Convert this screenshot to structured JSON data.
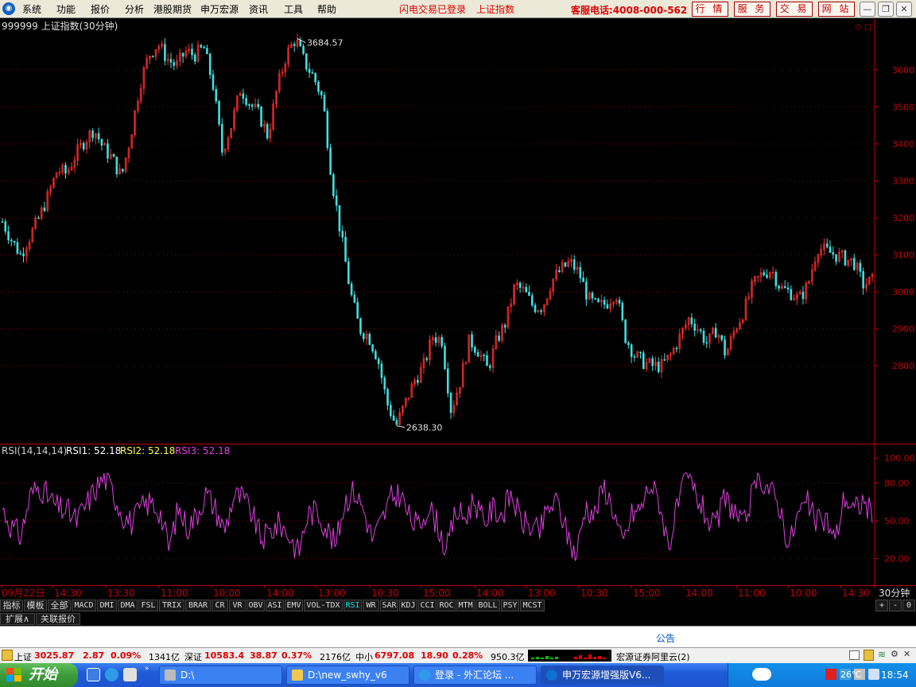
{
  "menubar": {
    "items": [
      "系统",
      "功能",
      "报价",
      "分析",
      "港股期货",
      "申万宏源",
      "资讯",
      "工具",
      "帮助"
    ],
    "flash_status": "闪电交易已登录",
    "index_link": "上证指数",
    "hotline": "客服电话:4008-000-562",
    "buttons": [
      "行 情",
      "服 务",
      "交 易",
      "网 站"
    ]
  },
  "chart": {
    "title": "999999 上证指数(30分钟)",
    "high_label": "3684.57",
    "low_label": "2638.30",
    "rsi_header": "RSI(14,14,14)",
    "rsi1": "RSI1: 52.18",
    "rsi2": "RSI2: 52.18",
    "rsi3": "RSI3: 52.18",
    "period_label": "30分钟",
    "colors": {
      "up": "#ff3030",
      "down": "#40e0e0",
      "rsi": "#e040e0",
      "axis": "#c00000",
      "grid": "#800000"
    }
  },
  "chart_data": {
    "type": "line",
    "price_axis": {
      "ticks": [
        2800,
        2900,
        3000,
        3100,
        3200,
        3300,
        3400,
        3500,
        3600
      ],
      "ylim": [
        2620,
        3720
      ]
    },
    "rsi_axis": {
      "ticks": [
        "20.00",
        "50.00",
        "80.00",
        "100.00"
      ],
      "ylim": [
        0,
        100
      ]
    },
    "x_ticks": [
      "09月22日",
      "14:30",
      "13:30",
      "11:00",
      "10:00",
      "14:00",
      "13:00",
      "10:30",
      "15:00",
      "14:00",
      "13:00",
      "10:30",
      "15:00",
      "14:00",
      "11:00",
      "10:00",
      "14:30"
    ],
    "series": [
      {
        "name": "上证指数",
        "values": [
          3190,
          3140,
          3100,
          3150,
          3200,
          3260,
          3330,
          3320,
          3370,
          3410,
          3440,
          3390,
          3360,
          3310,
          3420,
          3560,
          3640,
          3670,
          3630,
          3610,
          3650,
          3640,
          3660,
          3560,
          3380,
          3450,
          3550,
          3510,
          3480,
          3420,
          3550,
          3640,
          3684.57,
          3620,
          3580,
          3520,
          3300,
          3150,
          3000,
          2900,
          2880,
          2820,
          2700,
          2638.3,
          2700,
          2760,
          2800,
          2880,
          2870,
          2680,
          2760,
          2870,
          2840,
          2790,
          2870,
          2920,
          3020,
          3000,
          2960,
          2960,
          3030,
          3060,
          3080,
          3050,
          2980,
          2960,
          2970,
          3000,
          2880,
          2830,
          2810,
          2800,
          2800,
          2830,
          2880,
          2930,
          2900,
          2860,
          2900,
          2830,
          2900,
          2950,
          3020,
          3050,
          3060,
          3010,
          3000,
          2980,
          3020,
          3120,
          3110,
          3100,
          3090,
          3080,
          3020,
          3030
        ]
      },
      {
        "name": "RSI",
        "values": [
          60,
          45,
          38,
          70,
          78,
          68,
          60,
          58,
          50,
          62,
          75,
          85,
          72,
          55,
          48,
          60,
          65,
          58,
          28,
          60,
          45,
          55,
          72,
          60,
          42,
          70,
          68,
          55,
          35,
          42,
          48,
          38,
          25,
          55,
          58,
          45,
          30,
          66,
          74,
          60,
          35,
          50,
          68,
          72,
          52,
          45,
          62,
          48,
          25,
          58,
          52,
          68,
          48,
          60,
          55,
          72,
          50,
          46,
          40,
          60,
          65,
          40,
          22,
          62,
          55,
          78,
          60,
          30,
          55,
          60,
          80,
          65,
          30,
          62,
          85,
          70,
          55,
          42,
          68,
          60,
          44,
          70,
          84,
          74,
          62,
          30,
          56,
          64,
          48,
          52,
          34,
          70,
          58,
          66,
          56
        ]
      }
    ]
  },
  "tabs": {
    "row1": [
      "指标",
      "模板",
      "全部",
      "MACD",
      "DMI",
      "DMA",
      "FSL",
      "TRIX",
      "BRAR",
      "CR",
      "VR",
      "OBV",
      "ASI",
      "EMV",
      "VOL-TDX",
      "RSI",
      "WR",
      "SAR",
      "KDJ",
      "CCI",
      "ROC",
      "MTM",
      "BOLL",
      "PSY",
      "MCST"
    ],
    "row2": [
      "扩展∧",
      "关联报价"
    ],
    "right": [
      "+",
      "-",
      "0"
    ]
  },
  "notice": "公告",
  "status": {
    "sh_name": "上证",
    "sh_val": "3025.87",
    "sh_chg": "2.87",
    "sh_pct": "0.09%",
    "sh_amt": "1341亿",
    "sz_name": "深证",
    "sz_val": "10583.4",
    "sz_chg": "38.87",
    "sz_pct": "0.37%",
    "sz_amt": "2176亿",
    "zx_name": "中小",
    "zx_val": "6797.08",
    "zx_chg": "18.90",
    "zx_pct": "0.28%",
    "zx_amt": "950.3亿",
    "server": "宏源证券阿里云(2)"
  },
  "taskbar": {
    "start": "开始",
    "tasks": [
      "D:\\",
      "D:\\new_swhy_v6",
      "登录 - 外汇论坛 ...",
      "申万宏源增强版V6..."
    ],
    "temperature": "26℃",
    "clock": "18:54"
  }
}
